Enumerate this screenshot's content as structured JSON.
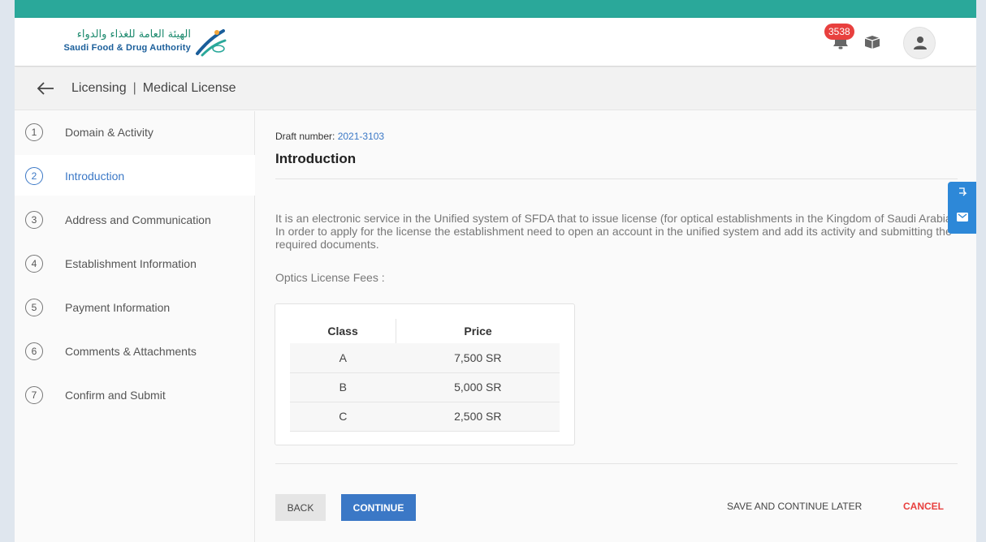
{
  "header": {
    "logo_arabic": "الهيئة العامة للغذاء والدواء",
    "logo_english": "Saudi Food & Drug Authority",
    "notification_count": "3538"
  },
  "breadcrumb": {
    "section": "Licensing",
    "page": "Medical License"
  },
  "steps": [
    {
      "number": "1",
      "label": "Domain & Activity"
    },
    {
      "number": "2",
      "label": "Introduction"
    },
    {
      "number": "3",
      "label": "Address and Communication"
    },
    {
      "number": "4",
      "label": "Establishment Information"
    },
    {
      "number": "5",
      "label": "Payment Information"
    },
    {
      "number": "6",
      "label": "Comments & Attachments"
    },
    {
      "number": "7",
      "label": "Confirm and Submit"
    }
  ],
  "active_step": 2,
  "main": {
    "draft_label": "Draft number:",
    "draft_number": "2021-3103",
    "title": "Introduction",
    "intro_text": "It is an electronic service in the Unified system of SFDA that to issue license (for optical establishments in the Kingdom of Saudi Arabia). In order to apply for the license the establishment need to open an account in the unified system and add its activity and submitting the required documents.",
    "fees_label": "Optics License Fees :",
    "table": {
      "headers": [
        "Class",
        "Price"
      ],
      "rows": [
        [
          "A",
          "7,500 SR"
        ],
        [
          "B",
          "5,000 SR"
        ],
        [
          "C",
          "2,500 SR"
        ]
      ]
    }
  },
  "actions": {
    "back": "BACK",
    "continue": "CONTINUE",
    "save_later": "SAVE AND CONTINUE LATER",
    "cancel": "CANCEL"
  },
  "colors": {
    "accent": "#3b78c6",
    "top_strip": "#2aa89a",
    "badge": "#e8403e",
    "cancel": "#e8403e",
    "side_widget": "#2d88d8"
  }
}
